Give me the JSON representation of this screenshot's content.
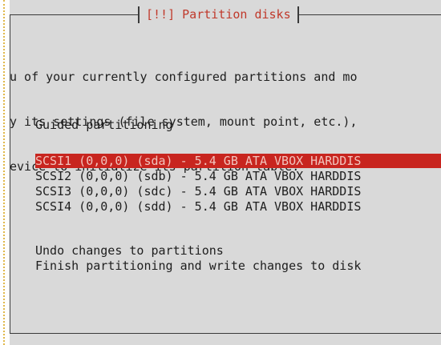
{
  "dialog": {
    "title": "[!!] Partition disks",
    "description_lines": [
      "u of your currently configured partitions and mo",
      "y its settings (file system, mount point, etc.),",
      "evice to initialize its partition table."
    ]
  },
  "menu": {
    "guided": "Guided partitioning",
    "disks": [
      "SCSI1 (0,0,0) (sda) - 5.4 GB ATA VBOX HARDDIS",
      "SCSI2 (0,0,0) (sdb) - 5.4 GB ATA VBOX HARDDIS",
      "SCSI3 (0,0,0) (sdc) - 5.4 GB ATA VBOX HARDDIS",
      "SCSI4 (0,0,0) (sdd) - 5.4 GB ATA VBOX HARDDIS"
    ],
    "undo": "Undo changes to partitions",
    "finish": "Finish partitioning and write changes to disk"
  },
  "colors": {
    "dialog_bg": "#d9d9d9",
    "highlight_bg": "#c8251f",
    "title_fg": "#c0392b"
  }
}
